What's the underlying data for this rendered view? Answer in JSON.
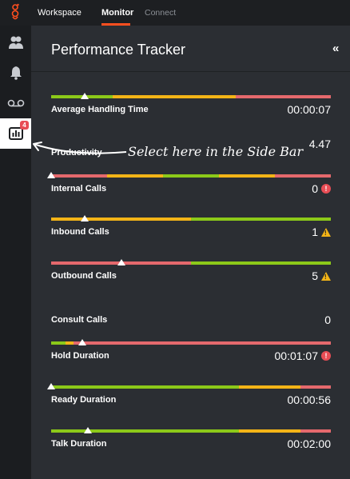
{
  "nav": {
    "workspace": "Workspace",
    "monitor": "Monitor",
    "connect": "Connect"
  },
  "sidebar": {
    "badge": "4"
  },
  "panel": {
    "title": "Performance Tracker",
    "collapse": "«"
  },
  "annotation": "Select here in the Side Bar",
  "colors": {
    "green": "#8cc919",
    "yellow": "#f3b417",
    "red": "#e5696d"
  },
  "metrics": [
    {
      "label": "Average Handling Time",
      "value": "00:00:07",
      "marker": 0.12,
      "segments": [
        [
          "green",
          0.22
        ],
        [
          "yellow",
          0.44
        ],
        [
          "red",
          0.34
        ]
      ]
    },
    {
      "label": "Productivity",
      "value": "4.47",
      "marker": null,
      "segments": []
    },
    {
      "label": "Internal Calls",
      "value": "0",
      "status": "error",
      "marker": 0.0,
      "segments": [
        [
          "red",
          0.2
        ],
        [
          "yellow",
          0.2
        ],
        [
          "green",
          0.2
        ],
        [
          "yellow",
          0.2
        ],
        [
          "red",
          0.2
        ]
      ]
    },
    {
      "label": "Inbound Calls",
      "value": "1",
      "status": "warning",
      "marker": 0.12,
      "segments": [
        [
          "yellow",
          0.5
        ],
        [
          "green",
          0.5
        ]
      ]
    },
    {
      "label": "Outbound Calls",
      "value": "5",
      "status": "warning",
      "marker": 0.25,
      "segments": [
        [
          "red",
          0.5
        ],
        [
          "green",
          0.5
        ]
      ]
    },
    {
      "label": "Consult Calls",
      "value": "0",
      "marker": null,
      "segments": []
    },
    {
      "label": "Hold Duration",
      "value": "00:01:07",
      "status": "error",
      "marker": 0.11,
      "segments": [
        [
          "green",
          0.05
        ],
        [
          "yellow",
          0.03
        ],
        [
          "red",
          0.92
        ]
      ]
    },
    {
      "label": "Ready Duration",
      "value": "00:00:56",
      "marker": 0.0,
      "segments": [
        [
          "green",
          0.67
        ],
        [
          "yellow",
          0.22
        ],
        [
          "red",
          0.11
        ]
      ]
    },
    {
      "label": "Talk Duration",
      "value": "00:02:00",
      "marker": 0.13,
      "segments": [
        [
          "green",
          0.67
        ],
        [
          "yellow",
          0.22
        ],
        [
          "red",
          0.11
        ]
      ]
    }
  ]
}
